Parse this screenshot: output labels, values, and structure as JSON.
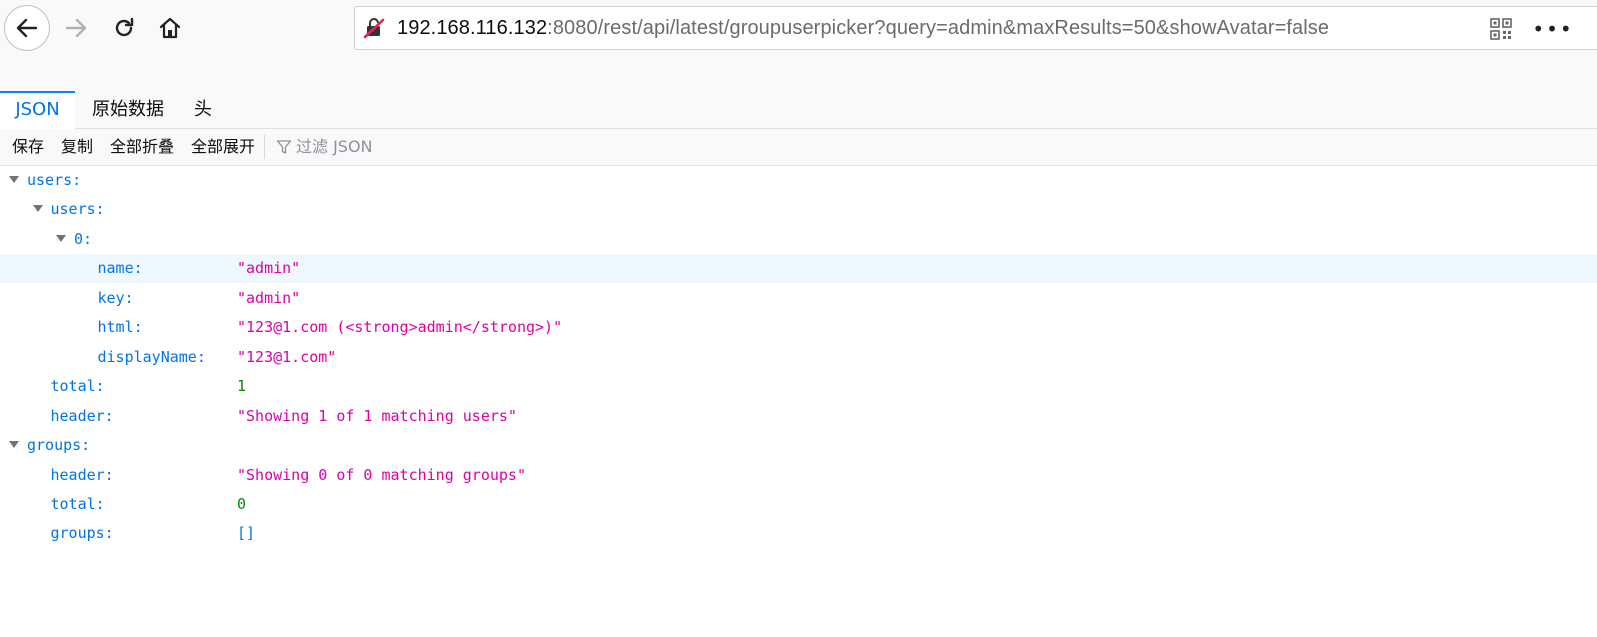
{
  "browser": {
    "url_host": "192.168.116.132",
    "url_rest": ":8080/rest/api/latest/groupuserpicker?query=admin&maxResults=50&showAvatar=false",
    "more_label": "•••"
  },
  "tabs": [
    {
      "label": "JSON",
      "active": true
    },
    {
      "label": "原始数据",
      "active": false
    },
    {
      "label": "头",
      "active": false
    }
  ],
  "json_toolbar": {
    "save": "保存",
    "copy": "复制",
    "collapse_all": "全部折叠",
    "expand_all": "全部展开",
    "filter_placeholder": "过滤 JSON"
  },
  "tree": [
    {
      "indent": 0,
      "expandable": true,
      "key": "users:",
      "value": "",
      "type": ""
    },
    {
      "indent": 1,
      "expandable": true,
      "key": "users:",
      "value": "",
      "type": ""
    },
    {
      "indent": 2,
      "expandable": true,
      "key": "0:",
      "value": "",
      "type": ""
    },
    {
      "indent": 3,
      "expandable": false,
      "key": "name:",
      "value": "\"admin\"",
      "type": "str",
      "selected": true
    },
    {
      "indent": 3,
      "expandable": false,
      "key": "key:",
      "value": "\"admin\"",
      "type": "str"
    },
    {
      "indent": 3,
      "expandable": false,
      "key": "html:",
      "value": "\"123@1.com (<strong>admin</strong>)\"",
      "type": "str"
    },
    {
      "indent": 3,
      "expandable": false,
      "key": "displayName:",
      "value": "\"123@1.com\"",
      "type": "str"
    },
    {
      "indent": 1,
      "expandable": false,
      "key": "total:",
      "value": "1",
      "type": "num"
    },
    {
      "indent": 1,
      "expandable": false,
      "key": "header:",
      "value": "\"Showing 1 of 1 matching users\"",
      "type": "str"
    },
    {
      "indent": 0,
      "expandable": true,
      "key": "groups:",
      "value": "",
      "type": ""
    },
    {
      "indent": 1,
      "expandable": false,
      "key": "header:",
      "value": "\"Showing 0 of 0 matching groups\"",
      "type": "str"
    },
    {
      "indent": 1,
      "expandable": false,
      "key": "total:",
      "value": "0",
      "type": "num"
    },
    {
      "indent": 1,
      "expandable": false,
      "key": "groups:",
      "value": "[]",
      "type": "arr"
    }
  ],
  "colors": {
    "accent": "#0a84ff",
    "key": "#0074e8",
    "string": "#dd00a9",
    "number": "#058b00"
  }
}
